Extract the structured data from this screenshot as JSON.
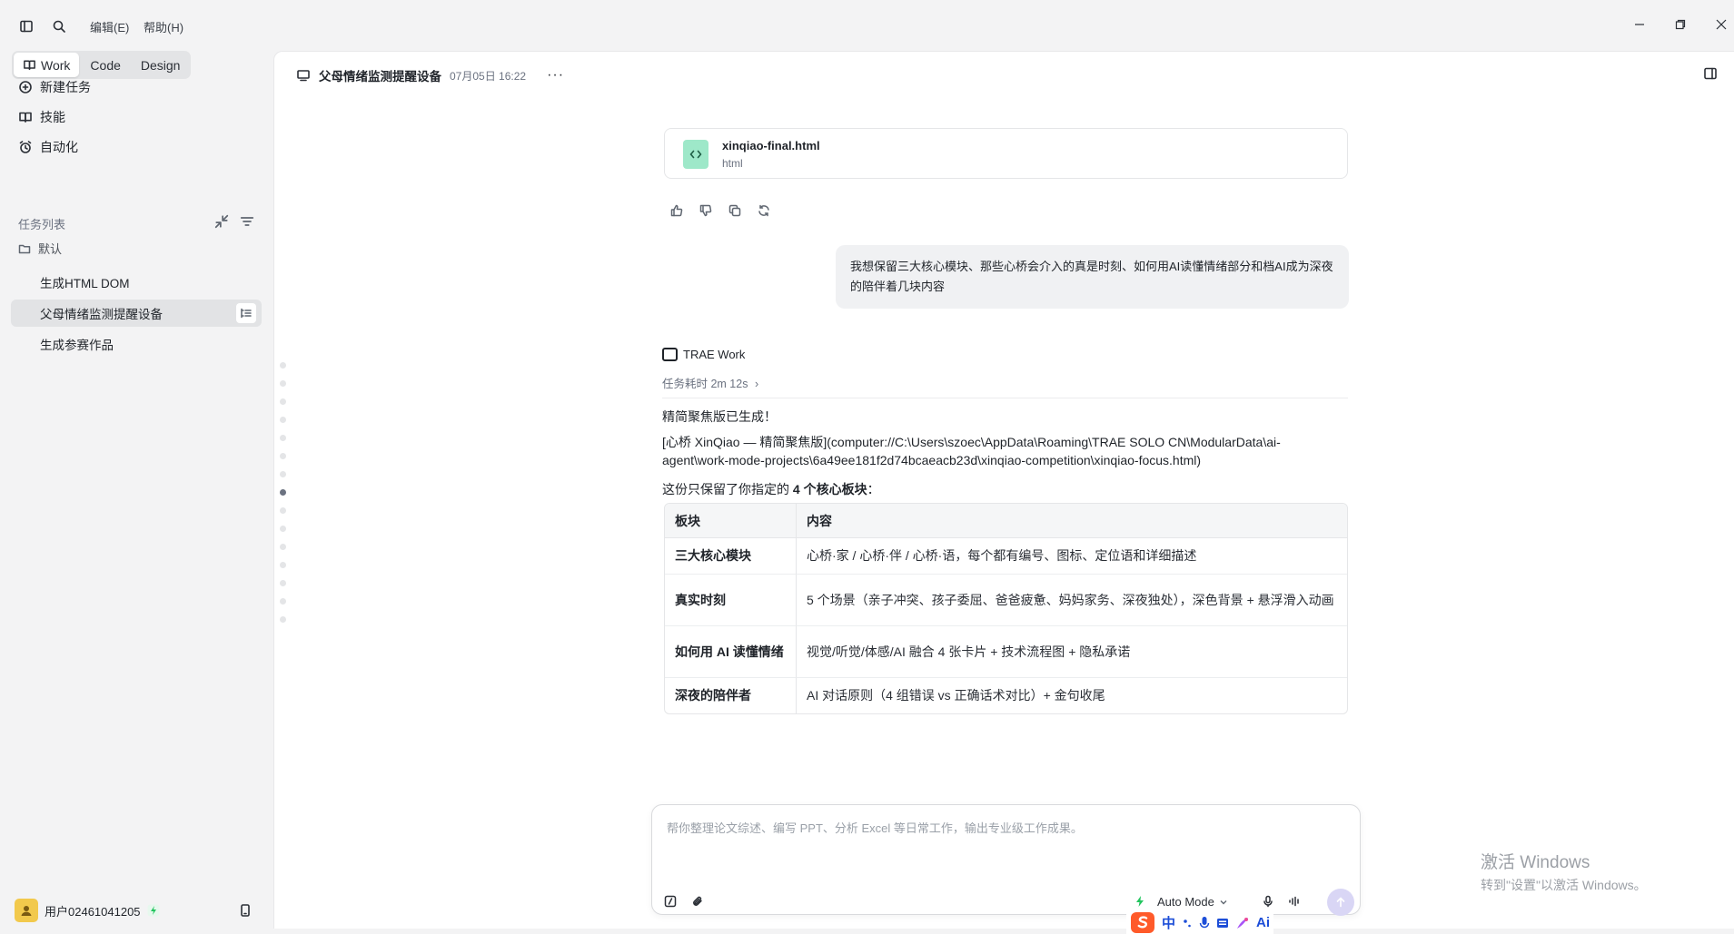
{
  "menu": {
    "edit": "编辑(E)",
    "help": "帮助(H)"
  },
  "modes": [
    "Work",
    "Code",
    "Design"
  ],
  "nav": {
    "new_task": "新建任务",
    "skills": "技能",
    "automation": "自动化"
  },
  "tasks_section": {
    "title": "任务列表",
    "group": "默认",
    "items": [
      "生成HTML DOM",
      "父母情绪监测提醒设备",
      "生成参赛作品"
    ]
  },
  "user": {
    "name": "用户02461041205"
  },
  "header": {
    "title": "父母情绪监测提醒设备",
    "date": "07月05日 16:22",
    "more": "···"
  },
  "file": {
    "name": "xinqiao-final.html",
    "type": "html"
  },
  "user_message": "我想保留三大核心模块、那些心桥会介入的真是时刻、如何用AI读懂情绪部分和档AI成为深夜的陪伴着几块内容",
  "agent": {
    "name": "TRAE Work",
    "time": "任务耗时 2m 12s"
  },
  "reply": {
    "p1": "精简聚焦版已生成！",
    "p2": "[心桥 XinQiao — 精简聚焦版](computer://C:\\Users\\szoec\\AppData\\Roaming\\TRAE SOLO CN\\ModularData\\ai-agent\\work-mode-projects\\6a49ee181f2d74bcaeacb23d\\xinqiao-competition\\xinqiao-focus.html)",
    "p3_prefix": "这份只保留了你指定的 ",
    "p3_bold": "4 个核心板块",
    "p3_suffix": "："
  },
  "table": {
    "headers": [
      "板块",
      "内容"
    ],
    "rows": [
      [
        "三大核心模块",
        "心桥·家 / 心桥·伴 / 心桥·语，每个都有编号、图标、定位语和详细描述"
      ],
      [
        "真实时刻",
        "5 个场景（亲子冲突、孩子委屈、爸爸疲惫、妈妈家务、深夜独处），深色背景 + 悬浮滑入动画"
      ],
      [
        "如何用 AI 读懂情绪",
        "视觉/听觉/体感/AI 融合 4 张卡片 + 技术流程图 + 隐私承诺"
      ],
      [
        "深夜的陪伴者",
        "AI 对话原则（4 组错误 vs 正确话术对比）+ 金句收尾"
      ]
    ]
  },
  "composer": {
    "placeholder": "帮你整理论文综述、编写 PPT、分析 Excel 等日常工作，输出专业级工作成果。",
    "mode": "Auto Mode"
  },
  "watermark": {
    "line1": "激活 Windows",
    "line2": "转到\"设置\"以激活 Windows。"
  },
  "ime": {
    "lang": "中",
    "ai": "Ai"
  },
  "colors": {
    "accent": "#d9d6f5",
    "file_icon": "#9ee8c9",
    "bolt": "#22c55e",
    "avatar": "#f2c94c"
  }
}
